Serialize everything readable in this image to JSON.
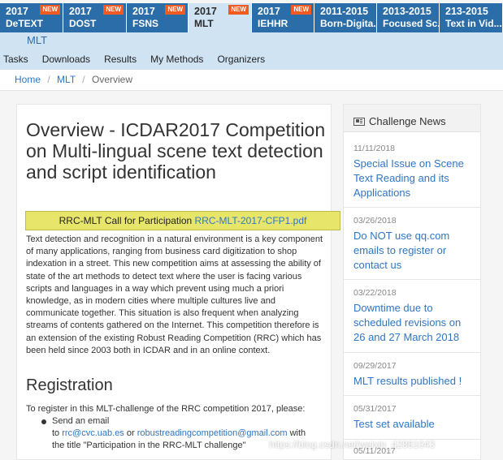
{
  "tabs": [
    {
      "year": "2017",
      "name": "DeTEXT",
      "is_new": true,
      "new_label": "NEW",
      "active": false,
      "width": 78
    },
    {
      "year": "2017",
      "name": "DOST",
      "is_new": true,
      "new_label": "NEW",
      "active": false,
      "width": 78
    },
    {
      "year": "2017",
      "name": "FSNS",
      "is_new": true,
      "new_label": "NEW",
      "active": false,
      "width": 76
    },
    {
      "year": "2017",
      "name": "MLT",
      "is_new": true,
      "new_label": "NEW",
      "active": true,
      "width": 78
    },
    {
      "year": "2017",
      "name": "IEHHR",
      "is_new": true,
      "new_label": "NEW",
      "active": false,
      "width": 77
    },
    {
      "year": "2011-2015",
      "name": "Born-Digita...",
      "is_new": false,
      "new_label": "",
      "active": false,
      "width": 77
    },
    {
      "year": "2013-2015",
      "name": "Focused Sc...",
      "is_new": false,
      "new_label": "",
      "active": false,
      "width": 77
    },
    {
      "year": "213-2015",
      "name": "Text in Vid...",
      "is_new": false,
      "new_label": "",
      "active": false,
      "width": 78
    }
  ],
  "subbar": {
    "title": "MLT"
  },
  "menu": [
    "Tasks",
    "Downloads",
    "Results",
    "My Methods",
    "Organizers"
  ],
  "breadcrumb": {
    "home": "Home",
    "section": "MLT",
    "current": "Overview",
    "sep": "/"
  },
  "main": {
    "title": "Overview - ICDAR2017 Competition on Multi-lingual scene text detection and script identification",
    "cfp_text": "RRC-MLT Call for Participation ",
    "cfp_link": "RRC-MLT-2017-CFP1.pdf",
    "paragraph": "Text detection and recognition in a natural environment is a key component of many applications, ranging from business card digitization to shop indexation in a street. This new competition aims at assessing the ability of state of the art methods to detect text where the user is facing various scripts and languages in a way which prevent using much a priori knowledge, as in modern cities where multiple cultures live and communicate together. This situation is also frequent when analyzing streams of contents gathered on the Internet. This competition therefore is an extension of the existing Robust Reading Competition (RRC) which has been held since 2003 both in ICDAR and in an online context.",
    "registration_heading": "Registration",
    "registration_text": "To register in this MLT-challenge of the RRC competition 2017, please:",
    "bullet_line1": "Send an email",
    "bullet_to": "to ",
    "email1": "rrc@cvc.uab.es",
    "or_word": " or ",
    "email2": "robustreadingcompetition@gmail.com",
    "with_word": " with",
    "bullet_line3": "the title \"Participation in the RRC-MLT challenge\""
  },
  "sidebar": {
    "title": "Challenge News",
    "news": [
      {
        "date": "11/11/2018",
        "title": "Special Issue on Scene Text Reading and its Applications"
      },
      {
        "date": "03/26/2018",
        "title": "Do NOT use qq.com emails to register or contact us"
      },
      {
        "date": "03/22/2018",
        "title": "Downtime due to scheduled revisions on 26 and 27 March 2018"
      },
      {
        "date": "09/29/2017",
        "title": "MLT results published !"
      },
      {
        "date": "05/31/2017",
        "title": "Test set available"
      },
      {
        "date": "05/11/2017",
        "title": ""
      }
    ]
  },
  "watermark": "https://blog.csdn.net/weixin_42861043"
}
